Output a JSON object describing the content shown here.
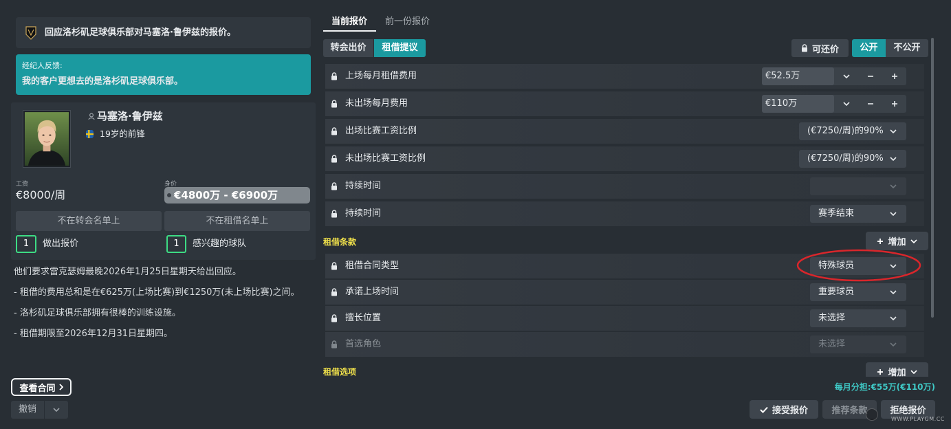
{
  "offer": {
    "header_text": "回应洛杉矶足球俱乐部对马塞洛·鲁伊兹的报价。",
    "agent_feedback_title": "经纪人反馈:",
    "agent_feedback_text": "我的客户更想去的是洛杉矶足球俱乐部。"
  },
  "player": {
    "name": "马塞洛·鲁伊兹",
    "description": "19岁的前锋",
    "wage_label": "工资",
    "wage": "€8000/周",
    "value_label": "身价",
    "value": "€4800万 - €6900万",
    "transfer_status": "不在转会名单上",
    "loan_status": "不在租借名单上",
    "offers_made_count": "1",
    "offers_made_label": "做出报价",
    "interested_clubs_count": "1",
    "interested_clubs_label": "感兴趣的球队"
  },
  "notes": [
    "他们要求雷克瑟姆最晚2026年1月25日星期天给出回应。",
    "- 租借的费用总和是在€625万(上场比赛)到€1250万(未上场比赛)之间。",
    "- 洛杉矶足球俱乐部拥有很棒的训练设施。",
    "- 租借期限至2026年12月31日星期四。"
  ],
  "left_actions": {
    "view_contract": "查看合同",
    "undo": "撤销"
  },
  "tabs": [
    {
      "label": "当前报价",
      "active": true
    },
    {
      "label": "前一份报价",
      "active": false
    }
  ],
  "offer_types": [
    {
      "label": "转会出价",
      "active": false
    },
    {
      "label": "租借提议",
      "active": true
    }
  ],
  "visibility": {
    "negotiable": "可还价",
    "public": "公开",
    "private": "不公开",
    "public_active": true
  },
  "terms": [
    {
      "label": "上场每月租借费用",
      "value": "€52.5万"
    },
    {
      "label": "未出场每月费用",
      "value": "€110万"
    },
    {
      "label": "出场比赛工资比例",
      "value": "(€7250/周)的90%"
    },
    {
      "label": "未出场比赛工资比例",
      "value": "(€7250/周)的90%"
    },
    {
      "label": "持续时间",
      "value": "",
      "disabled": true
    },
    {
      "label": "持续时间",
      "value": "赛季结束"
    }
  ],
  "loan_terms_section": {
    "title": "租借条款",
    "add_label": "增加",
    "items": [
      {
        "label": "租借合同类型",
        "value": "特殊球员",
        "highlighted": true
      },
      {
        "label": "承诺上场时间",
        "value": "重要球员"
      },
      {
        "label": "擅长位置",
        "value": "未选择"
      },
      {
        "label": "首选角色",
        "value": "未选择",
        "disabled": true
      }
    ]
  },
  "loan_options_section": {
    "title": "租借选项",
    "add_label": "增加"
  },
  "footer": {
    "monthly_share": "每月分担:€55万(€110万)",
    "accept": "接受报价",
    "recommend": "推荐条款",
    "reject": "拒绝报价"
  },
  "watermark": "WWW.PLAYGM.CC",
  "colors": {
    "background": "#282e34",
    "accent_teal": "#1b9aa0",
    "section_title_yellow": "#efe04b",
    "count_border_green": "#3ddc84",
    "footer_text_teal": "#3fc9c6",
    "annotation_red": "#d9262b"
  },
  "icons": {
    "club_crest": "lafc-crest-icon",
    "nationality": "sweden-flag-icon",
    "player": "person-icon",
    "term_lock": "lock-icon",
    "dropdown": "chevron-down-icon",
    "increase": "plus-icon",
    "decrease": "minus-icon",
    "accept": "check-icon",
    "view_contract": "chevron-right-icon"
  }
}
